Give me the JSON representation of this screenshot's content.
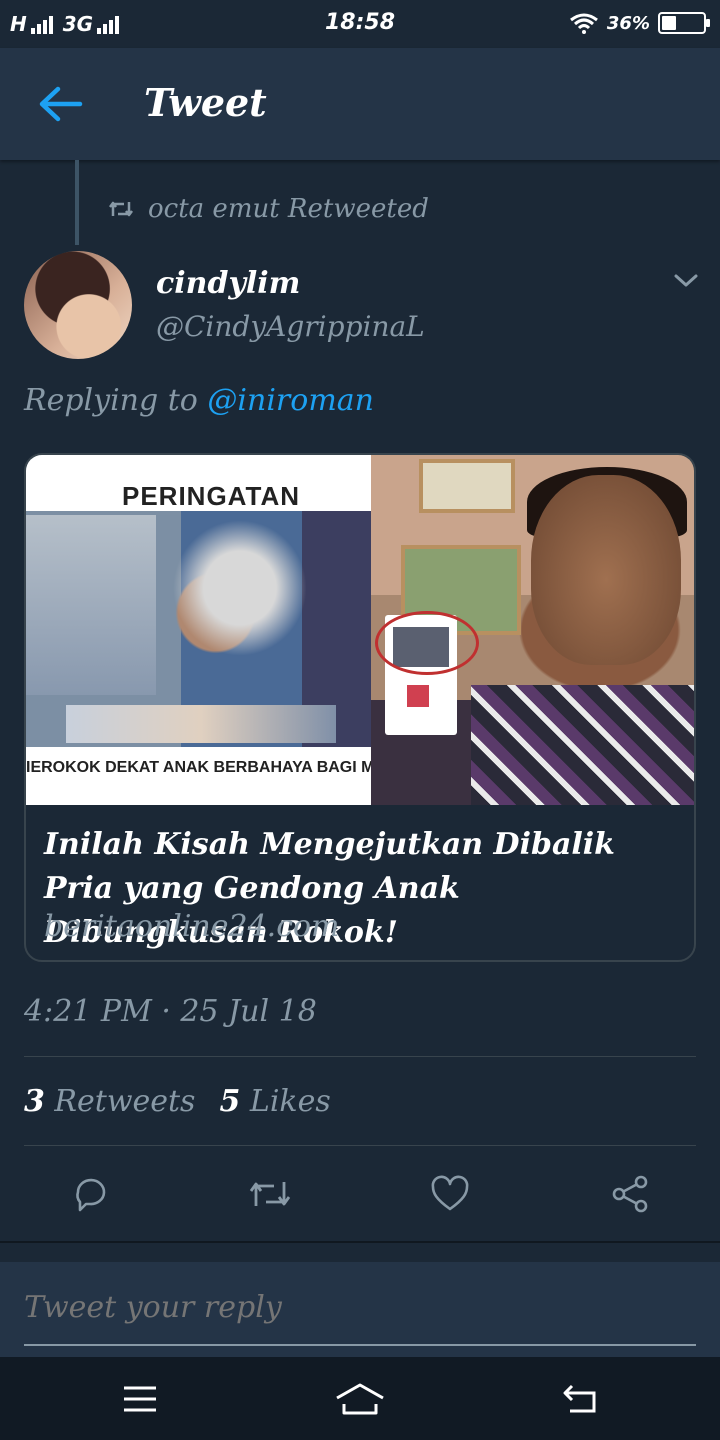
{
  "status_bar": {
    "network_left": "H",
    "network_mid": "3G",
    "time": "18:58",
    "battery_percent": "36%",
    "battery_level": 0.36
  },
  "header": {
    "title": "Tweet",
    "back_icon": "arrow-left-icon",
    "accent": "#1da1f2"
  },
  "retweet_context": {
    "icon": "retweet-icon",
    "label": "octa emut Retweeted"
  },
  "tweet": {
    "author_name": "cindylim",
    "author_handle": "@CindyAgrippinaL",
    "replying_prefix": "Replying to",
    "replying_mention": "@iniroman",
    "card": {
      "image_heading": "PERINGATAN",
      "image_caption": "IEROKOK DEKAT ANAK BERBAHAYA BAGI ME",
      "title": "Inilah Kisah Mengejutkan Dibalik Pria yang Gendong Anak Dibungkusan Rokok!",
      "domain": "beritaonline24.com"
    },
    "timestamp": "4:21 PM · 25 Jul 18",
    "retweets_count": "3",
    "retweets_label": "Retweets",
    "likes_count": "5",
    "likes_label": "Likes"
  },
  "actions": [
    "reply-icon",
    "retweet-icon",
    "like-icon",
    "share-icon"
  ],
  "reply_bar": {
    "placeholder": "Tweet your reply"
  },
  "nav": [
    "menu-icon",
    "home-icon",
    "back-icon"
  ],
  "colors": {
    "background": "#1b2836",
    "header": "#243447",
    "secondary_text": "#8899a6",
    "link": "#1da1f2",
    "border": "#38444d"
  }
}
